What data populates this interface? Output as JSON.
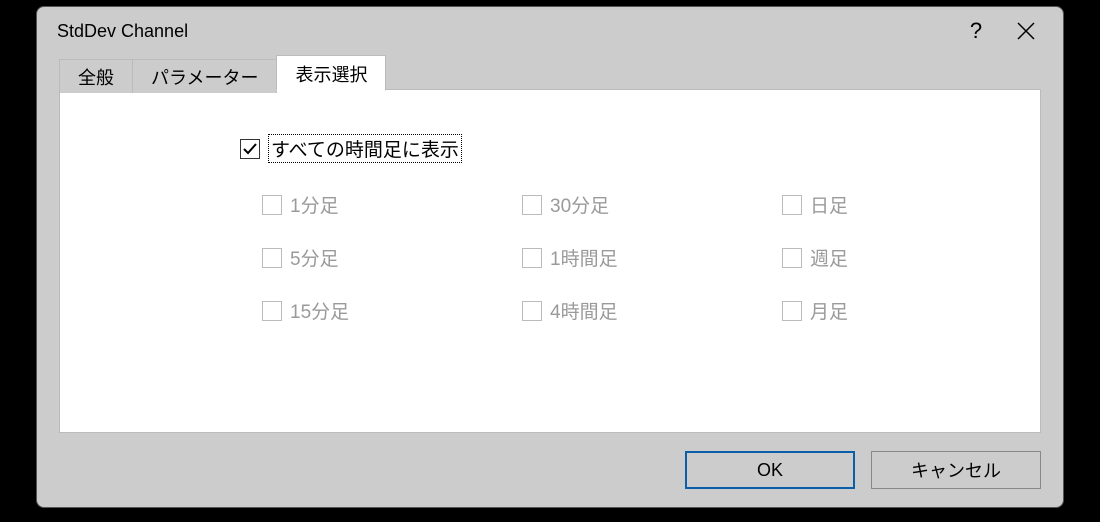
{
  "title": "StdDev Channel",
  "tabs": {
    "general": "全般",
    "parameters": "パラメーター",
    "display": "表示選択"
  },
  "master_checkbox_label": "すべての時間足に表示",
  "timeframes": {
    "m1": "1分足",
    "m5": "5分足",
    "m15": "15分足",
    "m30": "30分足",
    "h1": "1時間足",
    "h4": "4時間足",
    "d1": "日足",
    "w1": "週足",
    "mn1": "月足"
  },
  "buttons": {
    "ok": "OK",
    "cancel": "キャンセル"
  }
}
